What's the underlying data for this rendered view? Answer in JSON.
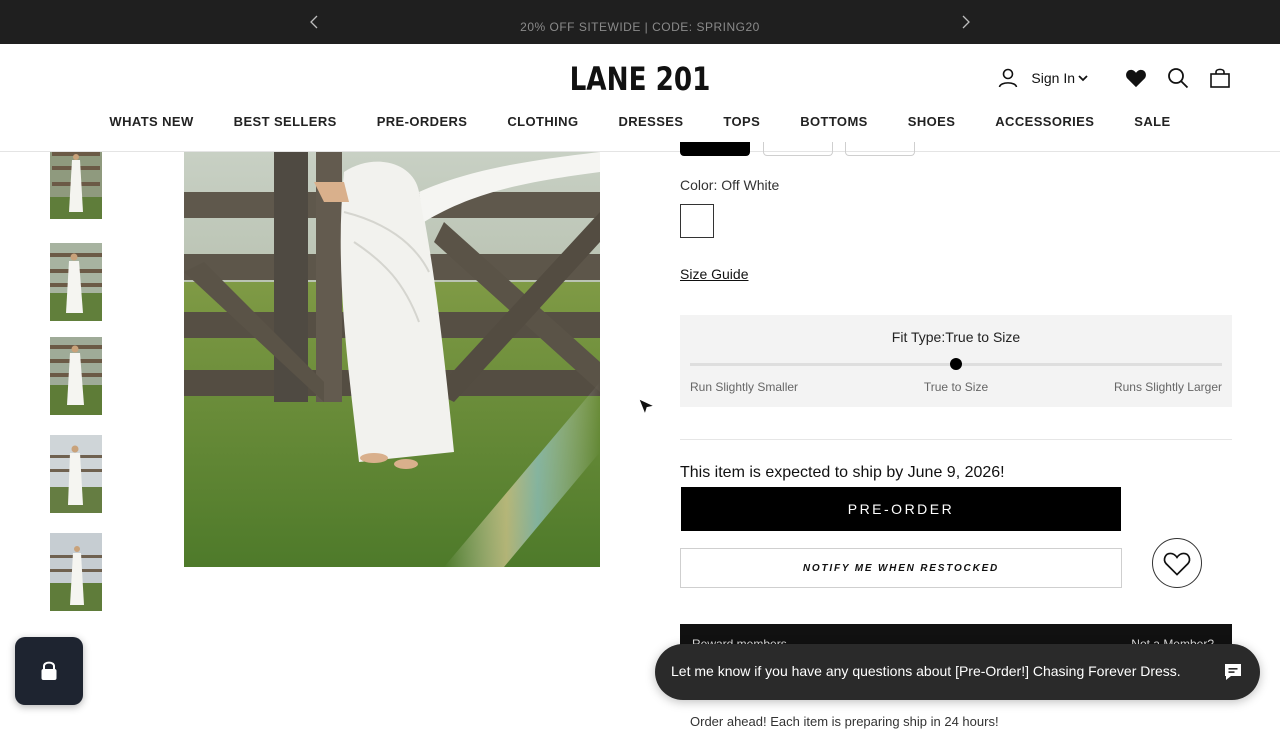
{
  "announcement": {
    "text": "20% OFF SITEWIDE | CODE: SPRING20"
  },
  "header": {
    "logo": "LANE 201",
    "sign_in": "Sign In"
  },
  "nav": {
    "items": [
      "WHATS NEW",
      "BEST SELLERS",
      "PRE-ORDERS",
      "CLOTHING",
      "DRESSES",
      "TOPS",
      "BOTTOMS",
      "SHOES",
      "ACCESSORIES",
      "SALE"
    ]
  },
  "product": {
    "color_label": "Color: Off White",
    "swatch_color": "#ffffff",
    "size_guide": "Size Guide",
    "fit": {
      "title": "Fit Type:True to Size",
      "left_label": "Run Slightly Smaller",
      "center_label": "True to Size",
      "right_label": "Runs Slightly Larger",
      "position": 0.5
    },
    "ship_text": "This item is expected to ship by June 9, 2026!",
    "preorder_button": "PRE-ORDER",
    "notify_button": "NOTIFY ME WHEN RESTOCKED"
  },
  "reward": {
    "left": "Reward members",
    "right": "Not a Member?"
  },
  "bottom_text": "Order ahead! Each item is preparing ship in 24 hours!",
  "chat": {
    "message": "Let me know if you have any questions about [Pre-Order!] Chasing Forever Dress."
  },
  "colors": {
    "announce_bg": "#1f1f1f",
    "primary": "#000000",
    "fit_bg": "#f3f3f3",
    "chat_bg": "#2a2a2a"
  }
}
